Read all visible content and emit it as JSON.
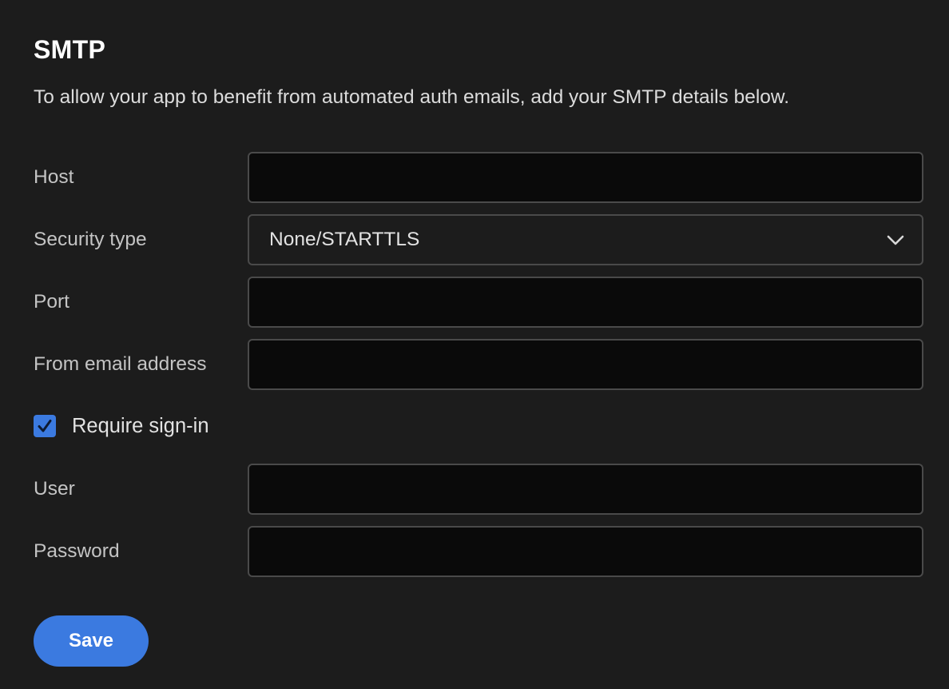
{
  "section": {
    "title": "SMTP",
    "description": "To allow your app to benefit from automated auth emails, add your SMTP details below."
  },
  "form": {
    "host": {
      "label": "Host",
      "value": ""
    },
    "security_type": {
      "label": "Security type",
      "selected": "None/STARTTLS",
      "icon": "chevron-down-icon"
    },
    "port": {
      "label": "Port",
      "value": ""
    },
    "from_email": {
      "label": "From email address",
      "value": ""
    },
    "require_signin": {
      "label": "Require sign-in",
      "checked": true,
      "icon": "checkmark-icon"
    },
    "user": {
      "label": "User",
      "value": ""
    },
    "password": {
      "label": "Password",
      "value": ""
    }
  },
  "actions": {
    "save_label": "Save"
  },
  "colors": {
    "background": "#1c1c1c",
    "input_background": "#0a0a0a",
    "input_border": "#4a4a4a",
    "accent": "#3b7ae0"
  }
}
